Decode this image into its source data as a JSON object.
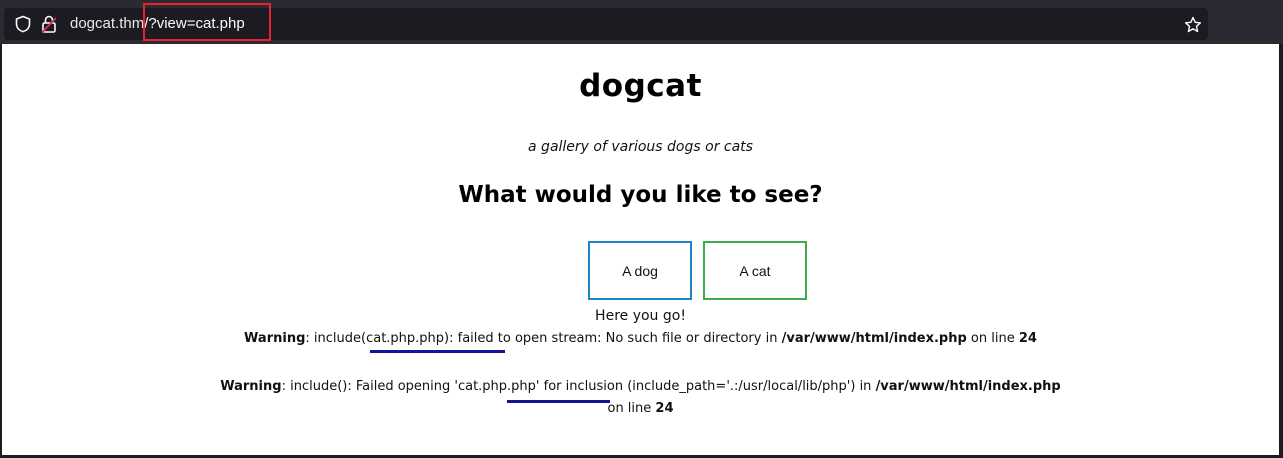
{
  "browser": {
    "url_host": "dogcat.thm",
    "url_path": "/?view=cat.php",
    "icons": {
      "tracking": "shield-icon",
      "security": "lock-broken-icon",
      "bookmark": "star-icon"
    },
    "highlight_color": "#e8232b"
  },
  "page": {
    "title": "dogcat",
    "tagline": "a gallery of various dogs or cats",
    "question": "What would you like to see?",
    "buttons": {
      "dog": "A dog",
      "cat": "A cat"
    },
    "result": "Here you go!",
    "warning1": {
      "label": "Warning",
      "sep": ": ",
      "func": "include(cat.php.php)",
      "msg": ": failed to open stream: No such file or directory in ",
      "path": "/var/www/html/index.php",
      "on_line": " on line ",
      "line": "24"
    },
    "warning2": {
      "label": "Warning",
      "sep": ": include(): Failed opening ",
      "file": "'cat.php.php'",
      "msg": " for inclusion (include_path='.:/usr/local/lib/php') in ",
      "path": "/var/www/html/index.php",
      "on_line": "on line ",
      "line": "24"
    },
    "colors": {
      "dog_border": "#1a84c4",
      "cat_border": "#3daa4b",
      "underline": "#13139a"
    }
  }
}
